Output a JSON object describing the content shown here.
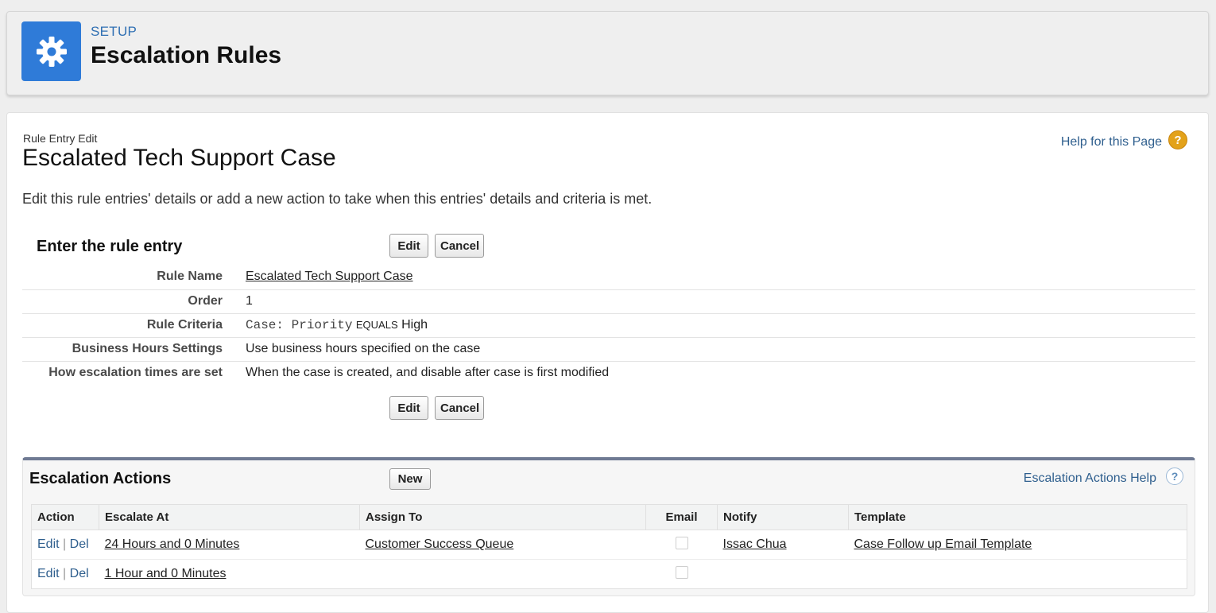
{
  "header": {
    "setup_label": "SETUP",
    "title": "Escalation Rules",
    "icon": "gear-icon",
    "icon_color": "#2f7bd8"
  },
  "page": {
    "subtitle": "Rule Entry Edit",
    "title": "Escalated Tech Support Case",
    "help_link": "Help for this Page",
    "help_icon": "question-circle-icon",
    "description": "Edit this rule entries' details or add a new action to take when this entries' details and criteria is met."
  },
  "rule_entry": {
    "heading": "Enter the rule entry",
    "edit_label": "Edit",
    "cancel_label": "Cancel",
    "fields": [
      {
        "label": "Rule Name",
        "value": "Escalated Tech Support Case"
      },
      {
        "label": "Order",
        "value": "1"
      },
      {
        "label": "Rule Criteria",
        "value_field": "Case: Priority",
        "value_op": "EQUALS",
        "value_val": "High"
      },
      {
        "label": "Business Hours Settings",
        "value": "Use business hours specified on the case"
      },
      {
        "label": "How escalation times are set",
        "value": "When the case is created, and disable after case is first modified"
      }
    ]
  },
  "escalation_actions": {
    "title": "Escalation Actions",
    "new_label": "New",
    "help_link": "Escalation Actions Help",
    "accent_color": "#6f7a93",
    "columns": [
      "Action",
      "Escalate At",
      "Assign To",
      "Email",
      "Notify",
      "Template"
    ],
    "rows": [
      {
        "edit": "Edit",
        "sep": "|",
        "del": "Del",
        "escalate_at": "24 Hours and 0 Minutes",
        "assign_to": "Customer Success Queue",
        "email": false,
        "notify": "Issac Chua",
        "template": "Case Follow up Email Template"
      },
      {
        "edit": "Edit",
        "sep": "|",
        "del": "Del",
        "escalate_at": "1 Hour and 0 Minutes",
        "assign_to": "",
        "email": false,
        "notify": "",
        "template": ""
      }
    ]
  }
}
